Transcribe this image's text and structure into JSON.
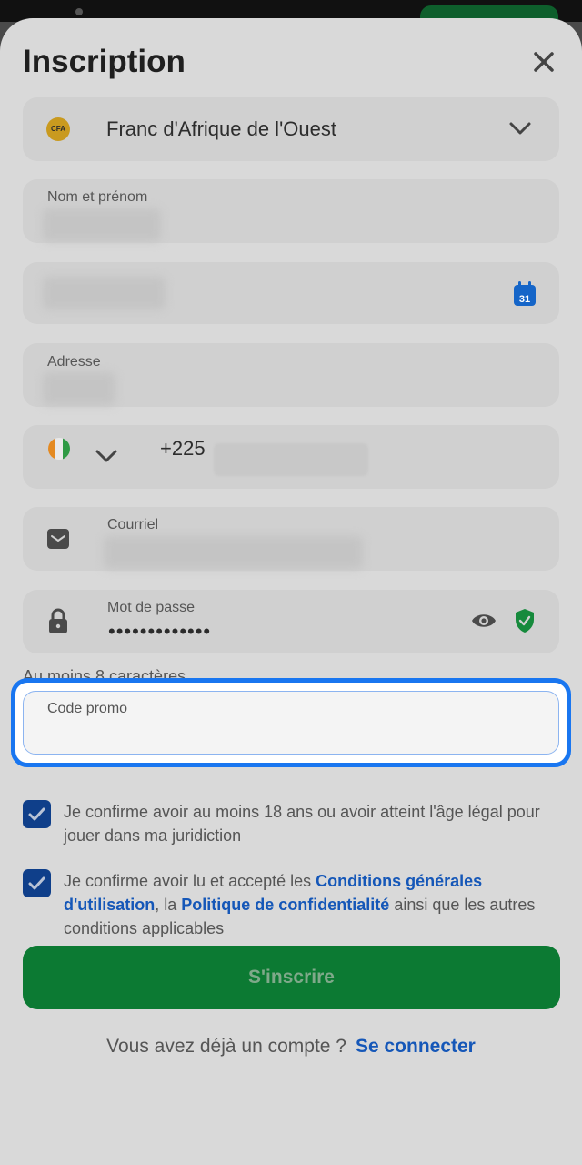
{
  "title": "Inscription",
  "currency": {
    "badge": "CFA",
    "label": "Franc d'Afrique de l'Ouest"
  },
  "fields": {
    "name_label": "Nom et prénom",
    "address_label": "Adresse",
    "phone_code": "+225",
    "email_label": "Courriel",
    "password_label": "Mot de passe",
    "password_value": "•••••••••••••"
  },
  "calendar_day": "31",
  "password_hint": "Au moins 8 caractères",
  "promo": {
    "label": "Code promo",
    "value": ""
  },
  "checks": {
    "age_text": "Je confirme avoir au moins 18 ans ou avoir atteint l'âge légal pour jouer dans ma juridiction",
    "terms_prefix": "Je confirme avoir lu et accepté les ",
    "terms_link": "Conditions générales d'utilisation",
    "terms_middle": ", la ",
    "privacy_link": "Politique de confidentialité",
    "terms_suffix": " ainsi que les autres conditions applicables"
  },
  "submit_label": "S'inscrire",
  "login": {
    "question": "Vous avez déjà un compte ?",
    "link": "Se connecter"
  },
  "colors": {
    "accent": "#1976f0",
    "brand_green": "#0c7a33",
    "link_blue": "#1557b8",
    "checkbox": "#0f3f8a"
  },
  "icons": [
    "close-icon",
    "chevron-down-icon",
    "calendar-icon",
    "email-icon",
    "lock-icon",
    "eye-icon",
    "shield-check-icon",
    "check-icon"
  ]
}
